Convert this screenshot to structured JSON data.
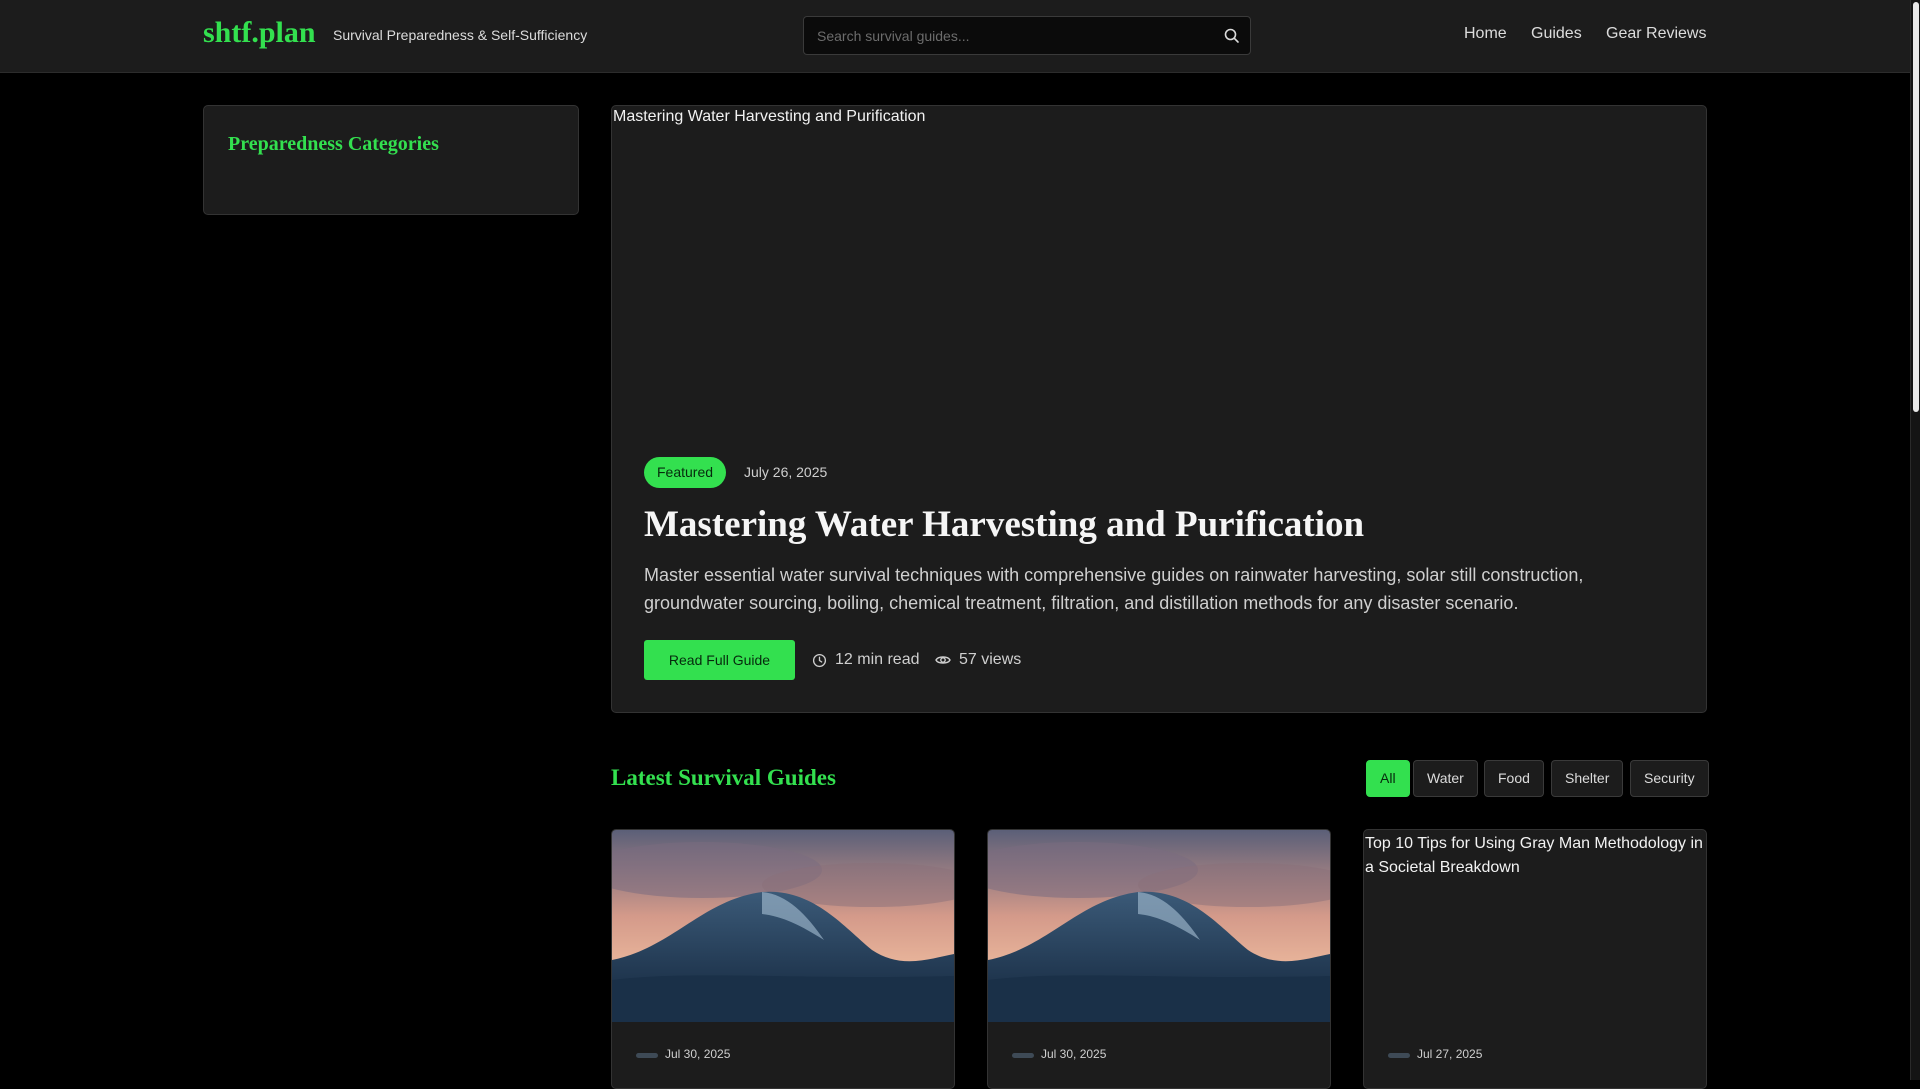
{
  "header": {
    "logo": "shtf.plan",
    "tagline": "Survival Preparedness & Self-Sufficiency",
    "search_placeholder": "Search survival guides...",
    "nav": [
      "Home",
      "Guides",
      "Gear Reviews"
    ]
  },
  "sidebar": {
    "title": "Preparedness Categories"
  },
  "featured": {
    "image_alt": "Mastering Water Harvesting and Purification",
    "badge": "Featured",
    "date": "July 26, 2025",
    "title": "Mastering Water Harvesting and Purification",
    "description": "Master essential water survival techniques with comprehensive guides on rainwater harvesting, solar still construction, groundwater sourcing, boiling, chemical treatment, filtration, and distillation methods for any disaster scenario.",
    "button": "Read Full Guide",
    "read_time": "12 min read",
    "views": "57 views"
  },
  "latest": {
    "title": "Latest Survival Guides",
    "filters": [
      "All",
      "Water",
      "Food",
      "Shelter",
      "Security"
    ],
    "active_filter": "All",
    "cards": [
      {
        "date": "Jul 30, 2025",
        "image": "wave-photo"
      },
      {
        "date": "Jul 30, 2025",
        "image": "wave-photo"
      },
      {
        "date": "Jul 27, 2025",
        "image_alt": "Top 10 Tips for Using Gray Man Methodology in a Societal Breakdown"
      }
    ]
  },
  "colors": {
    "accent": "#33e04f",
    "background": "#000000",
    "surface": "#1c1c1c"
  }
}
